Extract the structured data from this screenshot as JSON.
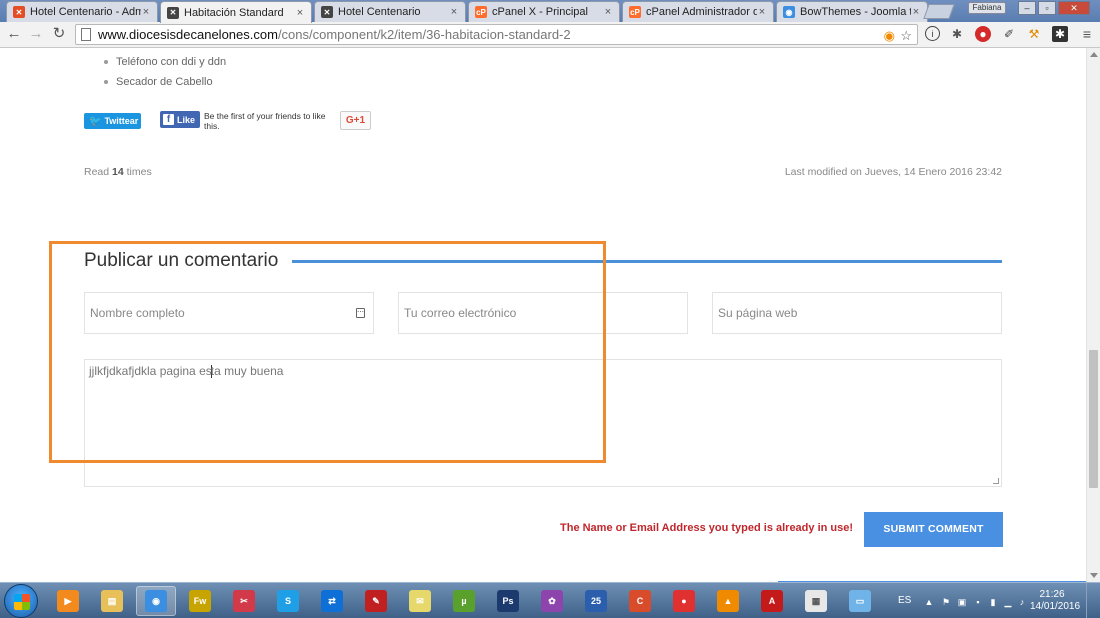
{
  "browser": {
    "tabs": [
      {
        "title": "Hotel Centenario - Admin",
        "icon": "joomla-icon",
        "color": "#e44d26",
        "glyph": "✕"
      },
      {
        "title": "Habitación Standard",
        "icon": "site-favicon-icon",
        "color": "#444444",
        "glyph": "✕"
      },
      {
        "title": "Hotel Centenario",
        "icon": "site-favicon-icon",
        "color": "#444444",
        "glyph": "✕"
      },
      {
        "title": "cPanel X - Principal",
        "icon": "cpanel-icon",
        "color": "#ff6c2c",
        "glyph": "cP"
      },
      {
        "title": "cPanel Administrador de",
        "icon": "cpanel-icon",
        "color": "#ff6c2c",
        "glyph": "cP"
      },
      {
        "title": "BowThemes - Joomla tem",
        "icon": "chrome-icon",
        "color": "#3b8ee0",
        "glyph": "◉"
      }
    ],
    "user": "Fabiana",
    "url_host": "www.diocesisdecanelones.com",
    "url_path": "/cons/component/k2/item/36-habitacion-standard-2"
  },
  "content": {
    "amenities": [
      "Teléfono con ddi y ddn",
      "Secador de Cabello"
    ],
    "share": {
      "twitter_label": "Twittear",
      "fb_label": "Like",
      "fb_text": "Be the first of your friends to like this.",
      "gplus_label": "G+1"
    },
    "read_prefix": "Read",
    "read_count": "14",
    "read_suffix": "times",
    "last_modified": "Last modified on Jueves, 14 Enero 2016 23:42"
  },
  "comment_form": {
    "title": "Publicar un comentario",
    "name_placeholder": "Nombre completo",
    "email_placeholder": "Tu correo electrónico",
    "web_placeholder": "Su página web",
    "text_before_caret": "jjlkfjdkafjdkla pagina es",
    "text_after_caret": "ta muy buena",
    "error": "The Name or Email Address you typed is already in use!",
    "submit_label": "SUBMIT COMMENT"
  },
  "taskbar": {
    "apps": [
      {
        "name": "windows-media-player-icon",
        "color": "#f28a1e",
        "glyph": "▶"
      },
      {
        "name": "file-explorer-icon",
        "color": "#e8c05a",
        "glyph": "▤"
      },
      {
        "name": "chrome-icon",
        "color": "#3b8ee0",
        "glyph": "◉",
        "active": true
      },
      {
        "name": "fireworks-icon",
        "color": "#c8a400",
        "glyph": "Fw"
      },
      {
        "name": "paint-icon",
        "color": "#d23a4a",
        "glyph": "✂"
      },
      {
        "name": "skype-icon",
        "color": "#1fa0e6",
        "glyph": "S"
      },
      {
        "name": "teamviewer-icon",
        "color": "#0e6fd6",
        "glyph": "⇄"
      },
      {
        "name": "pen-tool-icon",
        "color": "#c02020",
        "glyph": "✎"
      },
      {
        "name": "notes-icon",
        "color": "#e6d86a",
        "glyph": "✉"
      },
      {
        "name": "utorrent-icon",
        "color": "#5aa02c",
        "glyph": "µ"
      },
      {
        "name": "photoshop-icon",
        "color": "#1c3a6e",
        "glyph": "Ps"
      },
      {
        "name": "picasa-icon",
        "color": "#8e44ad",
        "glyph": "✿"
      },
      {
        "name": "media-icon",
        "color": "#2b5fae",
        "glyph": "25"
      },
      {
        "name": "ccleaner-icon",
        "color": "#d94c2b",
        "glyph": "C"
      },
      {
        "name": "camera-app-icon",
        "color": "#e03030",
        "glyph": "●"
      },
      {
        "name": "vlc-icon",
        "color": "#f08a00",
        "glyph": "▲"
      },
      {
        "name": "acrobat-icon",
        "color": "#c41a1a",
        "glyph": "A"
      },
      {
        "name": "apps-grid-icon",
        "color": "#e7e7e7",
        "glyph": "▦"
      },
      {
        "name": "window-icon",
        "color": "#6fb3e8",
        "glyph": "▭"
      }
    ],
    "lang": "ES",
    "time": "21:26",
    "date": "14/01/2016"
  }
}
